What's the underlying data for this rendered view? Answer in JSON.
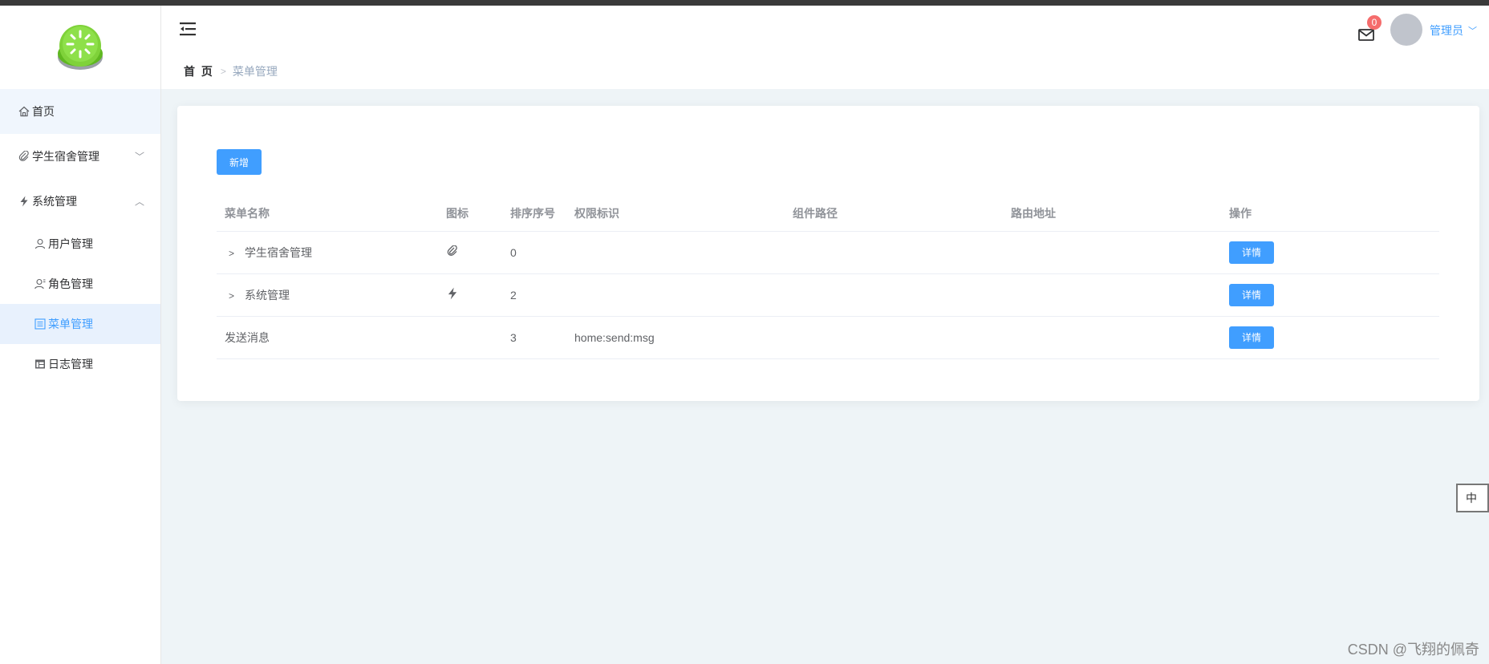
{
  "sidebar": {
    "items": [
      {
        "label": "首页",
        "icon": "home-icon"
      },
      {
        "label": "学生宿舍管理",
        "icon": "paperclip-icon"
      },
      {
        "label": "系统管理",
        "icon": "lightning-icon"
      },
      {
        "label": "用户管理",
        "icon": "user-icon"
      },
      {
        "label": "角色管理",
        "icon": "role-icon"
      },
      {
        "label": "菜单管理",
        "icon": "menu-icon"
      },
      {
        "label": "日志管理",
        "icon": "log-icon"
      }
    ]
  },
  "header": {
    "breadcrumb_home": "首 页",
    "breadcrumb_current": "菜单管理",
    "badge_count": "0",
    "username": "管理员"
  },
  "main": {
    "add_button": "新增",
    "columns": [
      "菜单名称",
      "图标",
      "排序序号",
      "权限标识",
      "组件路径",
      "路由地址",
      "操作"
    ],
    "rows": [
      {
        "name": "学生宿舍管理",
        "icon": "paperclip-icon",
        "order": "0",
        "perm": "",
        "component": "",
        "route": "",
        "action": "详情",
        "expandable": true
      },
      {
        "name": "系统管理",
        "icon": "lightning-icon",
        "order": "2",
        "perm": "",
        "component": "",
        "route": "",
        "action": "详情",
        "expandable": true
      },
      {
        "name": "发送消息",
        "icon": "",
        "order": "3",
        "perm": "home:send:msg",
        "component": "",
        "route": "",
        "action": "详情",
        "expandable": false
      }
    ]
  },
  "watermark": "CSDN @飞翔的佩奇",
  "ime_label": "中",
  "colors": {
    "accent": "#409eff",
    "badge": "#f56c6c",
    "sidebar_active": "#e8f1fd"
  }
}
